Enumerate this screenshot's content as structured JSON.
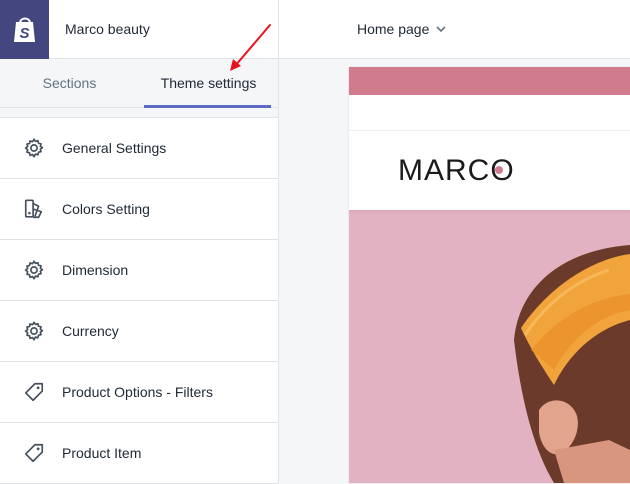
{
  "store": {
    "name": "Marco beauty",
    "logo_icon": "shopify-bag-icon"
  },
  "tabs": [
    {
      "label": "Sections",
      "active": false
    },
    {
      "label": "Theme settings",
      "active": true
    }
  ],
  "menu": [
    {
      "label": "General Settings",
      "icon": "gear-icon"
    },
    {
      "label": "Colors Setting",
      "icon": "paint-swatch-icon"
    },
    {
      "label": "Dimension",
      "icon": "gear-icon"
    },
    {
      "label": "Currency",
      "icon": "gear-icon"
    },
    {
      "label": "Product Options - Filters",
      "icon": "tag-icon"
    },
    {
      "label": "Product Item",
      "icon": "tag-icon"
    }
  ],
  "topbar": {
    "page_select": "Home page"
  },
  "preview": {
    "brand": "MARCO"
  },
  "colors": {
    "accent": "#5c6ac4",
    "logo_bg": "#43467f",
    "promo_bar": "#d17c8e",
    "hero_bg": "#e2b2c3",
    "annotation_arrow": "#e8121e"
  }
}
